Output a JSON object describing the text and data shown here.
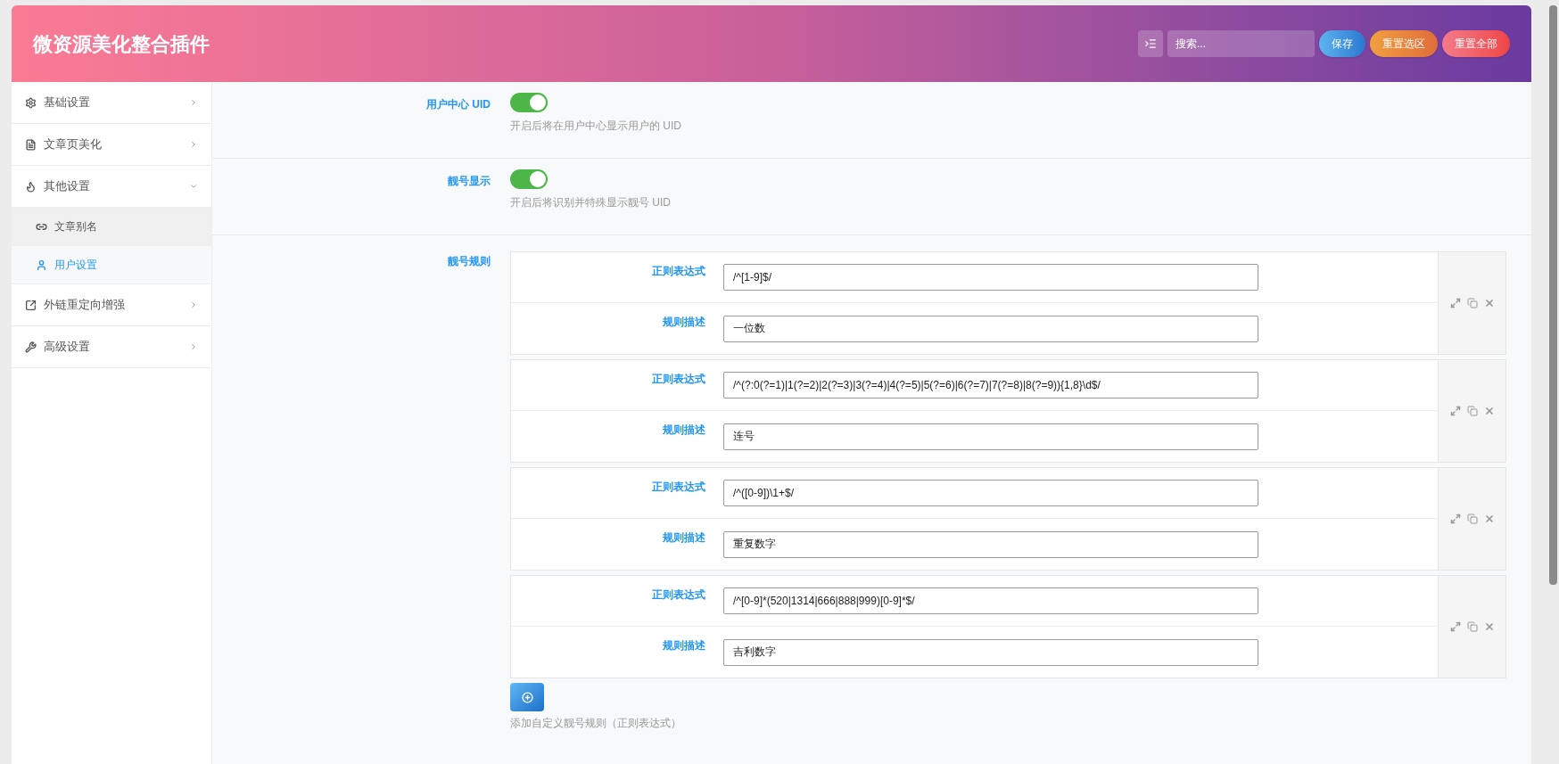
{
  "header": {
    "title": "微资源美化整合插件",
    "search": {
      "placeholder": "搜索..."
    },
    "buttons": [
      {
        "kind": "save",
        "label": "保存"
      },
      {
        "kind": "reset_section",
        "label": "重置选区"
      },
      {
        "kind": "reset_all",
        "label": "重置全部"
      }
    ]
  },
  "sidebar": {
    "items": [
      {
        "label": "基础设置",
        "expanded": false
      },
      {
        "label": "文章页美化",
        "expanded": false
      },
      {
        "label": "其他设置",
        "expanded": true,
        "children": [
          {
            "label": "文章别名",
            "selected": false
          },
          {
            "label": "用户设置",
            "selected": true
          }
        ]
      },
      {
        "label": "外链重定向增强",
        "expanded": false
      },
      {
        "label": "高级设置",
        "expanded": false
      }
    ]
  },
  "settings": [
    {
      "kind": "switch",
      "label": "用户中心 UID",
      "on": true,
      "help": "开启后将在用户中心显示用户的 UID"
    },
    {
      "kind": "switch",
      "label": "靓号显示",
      "on": true,
      "help": "开启后将识别并特殊显示靓号 UID"
    }
  ],
  "rules": {
    "label": "靓号规则",
    "items": [
      {
        "regex_label": "正则表达式",
        "regex": "/^[1-9]$/",
        "desc_label": "规则描述",
        "desc": "一位数"
      },
      {
        "regex_label": "正则表达式",
        "regex": "/^(?:0(?=1)|1(?=2)|2(?=3)|3(?=4)|4(?=5)|5(?=6)|6(?=7)|7(?=8)|8(?=9)){1,8}\\d$/",
        "desc_label": "规则描述",
        "desc": "连号"
      },
      {
        "regex_label": "正则表达式",
        "regex": "/^([0-9])\\1+$/",
        "desc_label": "规则描述",
        "desc": "重复数字"
      },
      {
        "regex_label": "正则表达式",
        "regex": "/^[0-9]*(520|1314|666|888|999)[0-9]*$/",
        "desc_label": "规则描述",
        "desc": "吉利数字"
      }
    ],
    "help": "添加自定义靓号规则（正则表达式）"
  }
}
